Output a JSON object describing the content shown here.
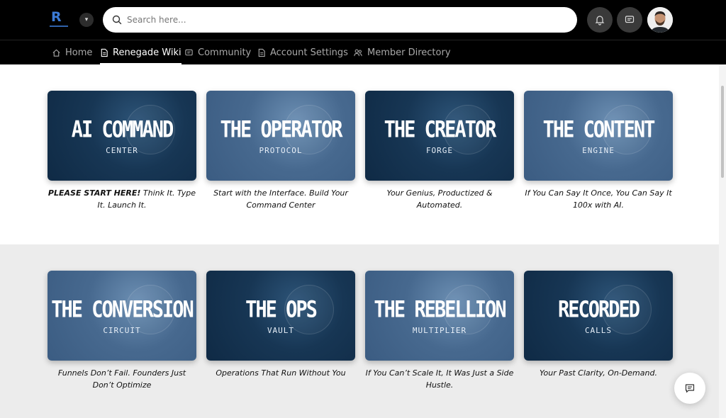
{
  "header": {
    "search_placeholder": "Search here...",
    "workspace_toggle_icon": "chevron-down-icon",
    "notification_icon": "bell-icon",
    "messages_icon": "message-icon"
  },
  "nav": {
    "items": [
      {
        "label": "Home",
        "icon": "home-icon",
        "active": false
      },
      {
        "label": "Renegade Wiki",
        "icon": "document-icon",
        "active": true
      },
      {
        "label": "Community",
        "icon": "chat-icon",
        "active": false
      },
      {
        "label": "Account Settings",
        "icon": "document-icon",
        "active": false
      },
      {
        "label": "Member Directory",
        "icon": "people-icon",
        "active": false
      }
    ]
  },
  "cards": [
    {
      "title": "AI COMMAND",
      "subtitle": "CENTER",
      "bold_prefix": "PLEASE START HERE!",
      "caption": " Think It. Type It. Launch It.",
      "theme": "dark"
    },
    {
      "title": "THE OPERATOR",
      "subtitle": "PROTOCOL",
      "bold_prefix": "",
      "caption": "Start with the Interface. Build Your Command Center",
      "theme": "light"
    },
    {
      "title": "THE CREATOR",
      "subtitle": "FORGE",
      "bold_prefix": "",
      "caption": "Your Genius, Productized & Automated.",
      "theme": "dark"
    },
    {
      "title": "THE CONTENT",
      "subtitle": "ENGINE",
      "bold_prefix": "",
      "caption": "If You Can Say It Once, You Can Say It 100x with AI.",
      "theme": "light"
    },
    {
      "title": "THE CONVERSION",
      "subtitle": "CIRCUIT",
      "bold_prefix": "",
      "caption": "Funnels Don’t Fail. Founders Just Don’t Optimize",
      "theme": "light"
    },
    {
      "title": "THE OPS",
      "subtitle": "VAULT",
      "bold_prefix": "",
      "caption": "Operations That Run Without You",
      "theme": "dark"
    },
    {
      "title": "THE REBELLION",
      "subtitle": "MULTIPLIER",
      "bold_prefix": "",
      "caption": "If You Can’t Scale It, It Was Just a Side Hustle.",
      "theme": "light"
    },
    {
      "title": "RECORDED",
      "subtitle": "CALLS",
      "bold_prefix": "",
      "caption": "Your Past Clarity, On-Demand.",
      "theme": "dark"
    }
  ],
  "colors": {
    "topbar": "#000000",
    "card_dark": "#173654",
    "card_light": "#47698f",
    "logo": "#3c7bd6"
  },
  "chat_fab_icon": "chat-bubble-icon"
}
